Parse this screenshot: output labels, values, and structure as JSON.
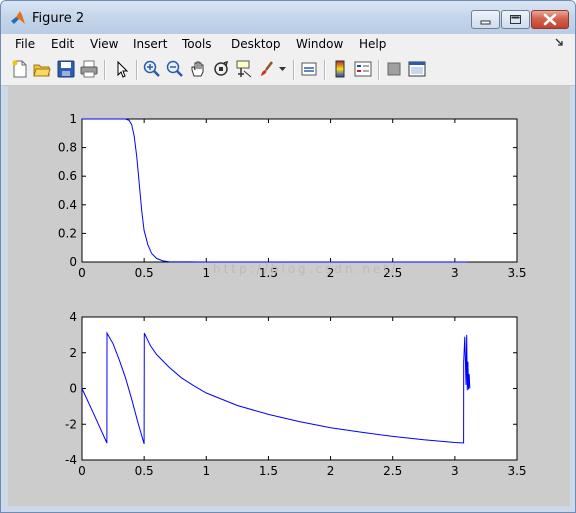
{
  "window": {
    "title": "Figure 2"
  },
  "menu": {
    "items": [
      {
        "label": "File"
      },
      {
        "label": "Edit"
      },
      {
        "label": "View"
      },
      {
        "label": "Insert"
      },
      {
        "label": "Tools"
      },
      {
        "label": "Desktop"
      },
      {
        "label": "Window"
      },
      {
        "label": "Help"
      }
    ]
  },
  "toolbar": {
    "buttons": [
      "new-figure",
      "open-file",
      "save",
      "print",
      "edit-plot",
      "zoom-in",
      "zoom-out",
      "pan",
      "rotate-3d",
      "data-cursor",
      "brush",
      "link-plot",
      "colorbar",
      "legend",
      "hide-plot-tools",
      "show-plot-tools"
    ]
  },
  "watermark": "http://blog.csdn.net/",
  "chart_data": [
    {
      "type": "line",
      "xlim": [
        0,
        3.5
      ],
      "ylim": [
        0,
        1
      ],
      "xticks": [
        "0",
        "0.5",
        "1",
        "1.5",
        "2",
        "2.5",
        "3",
        "3.5"
      ],
      "yticks": [
        "0",
        "0.2",
        "0.4",
        "0.6",
        "0.8",
        "1"
      ],
      "grid": false,
      "series": [
        {
          "color": "#0000ff",
          "x": [
            0,
            0.35,
            0.38,
            0.4,
            0.42,
            0.44,
            0.46,
            0.48,
            0.5,
            0.53,
            0.56,
            0.6,
            0.65,
            0.7,
            1.0,
            2.0,
            3.1
          ],
          "y": [
            1,
            1,
            0.99,
            0.96,
            0.88,
            0.74,
            0.55,
            0.36,
            0.22,
            0.12,
            0.06,
            0.025,
            0.008,
            0.002,
            0,
            0,
            0
          ]
        }
      ]
    },
    {
      "type": "line",
      "xlim": [
        0,
        3.5
      ],
      "ylim": [
        -4,
        4
      ],
      "xticks": [
        "0",
        "0.5",
        "1",
        "1.5",
        "2",
        "2.5",
        "3",
        "3.5"
      ],
      "yticks": [
        "-4",
        "-2",
        "0",
        "2",
        "4"
      ],
      "grid": false,
      "series": [
        {
          "color": "#0000ff",
          "x": [
            0,
            0.1,
            0.2,
            0.201,
            0.25,
            0.3,
            0.35,
            0.4,
            0.45,
            0.5,
            0.501,
            0.55,
            0.6,
            0.7,
            0.8,
            0.9,
            1.0,
            1.25,
            1.5,
            1.75,
            2.0,
            2.25,
            2.5,
            2.75,
            3.0,
            3.07,
            3.071,
            3.08,
            3.09,
            3.095,
            3.1,
            3.105,
            3.11,
            3.115,
            3.12
          ],
          "y": [
            0,
            -1.5,
            -3.05,
            3.1,
            2.5,
            1.6,
            0.6,
            -0.6,
            -1.9,
            -3.1,
            3.1,
            2.4,
            1.9,
            1.2,
            0.6,
            0.15,
            -0.25,
            -0.95,
            -1.45,
            -1.85,
            -2.2,
            -2.45,
            -2.68,
            -2.87,
            -3.02,
            -3.05,
            1.5,
            2.9,
            0.2,
            3.0,
            -0.1,
            1.5,
            -0.05,
            0.8,
            0
          ]
        }
      ]
    }
  ]
}
